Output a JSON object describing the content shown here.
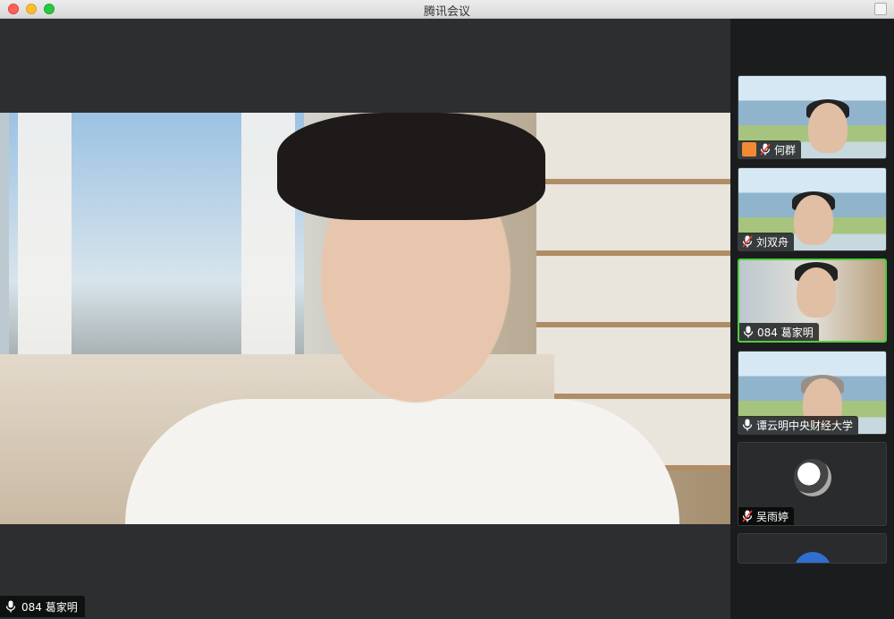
{
  "window": {
    "title": "腾讯会议"
  },
  "main_video": {
    "speaker_label": "084 葛家明"
  },
  "participants": [
    {
      "name": "何群",
      "icon": "user-icon",
      "mic": "mic-muted-icon",
      "thumb": "banner"
    },
    {
      "name": "刘双舟",
      "icon": "",
      "mic": "mic-muted-icon",
      "thumb": "banner"
    },
    {
      "name": "084 葛家明",
      "icon": "",
      "mic": "mic-icon",
      "thumb": "room",
      "active": true
    },
    {
      "name": "谭云明中央财经大学",
      "icon": "",
      "mic": "mic-icon",
      "thumb": "banner"
    },
    {
      "name": "吴雨婷",
      "icon": "",
      "mic": "mic-muted-icon",
      "thumb": "avatar"
    }
  ],
  "colors": {
    "active_border": "#4ece3e",
    "muted_mic": "#ff3b30"
  }
}
